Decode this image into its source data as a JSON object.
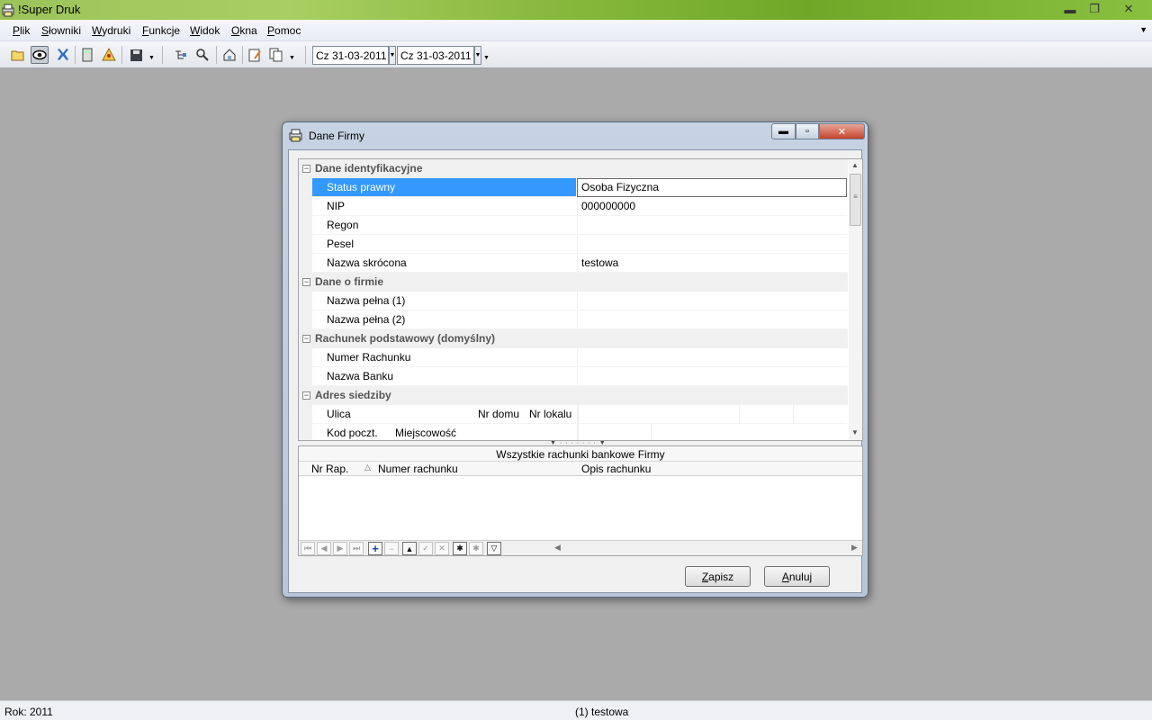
{
  "app": {
    "title": "!Super Druk",
    "caption_minimize": "▬",
    "caption_restore": "❐",
    "caption_close": "✕"
  },
  "menu": {
    "items": [
      {
        "accel": "P",
        "rest": "lik"
      },
      {
        "accel": "S",
        "rest": "łowniki"
      },
      {
        "accel": "W",
        "rest": "ydruki"
      },
      {
        "accel": "F",
        "rest": "unkcje"
      },
      {
        "accel": "W",
        "rest": "idok"
      },
      {
        "accel": "O",
        "rest": "kna"
      },
      {
        "accel": "P",
        "rest": "omoc"
      }
    ],
    "overflow": "▼"
  },
  "toolbar": {
    "date_from": "Cz 31-03-2011",
    "date_to": "Cz 31-03-2011",
    "caret": "▼"
  },
  "status": {
    "year": "Rok: 2011",
    "company": "(1) testowa"
  },
  "dialog": {
    "title": "Dane Firmy",
    "caption_min": "▬",
    "caption_max": "▫",
    "caption_close": "✕",
    "toggle": "−",
    "categories": {
      "identification": "Dane identyfikacyjne",
      "about": "Dane o firmie",
      "account": "Rachunek podstawowy (domyślny)",
      "address": "Adres siedziby"
    },
    "fields": {
      "status_label": "Status prawny",
      "status_value": "Osoba Fizyczna",
      "nip_label": "NIP",
      "nip_value": "000000000",
      "regon_label": "Regon",
      "pesel_label": "Pesel",
      "short_name_label": "Nazwa skrócona",
      "short_name_value": "testowa",
      "full_name1_label": "Nazwa pełna (1)",
      "full_name2_label": "Nazwa pełna (2)",
      "account_number_label": "Numer Rachunku",
      "bank_name_label": "Nazwa Banku",
      "street_label": "Ulica",
      "house_no_label": "Nr domu",
      "flat_no_label": "Nr lokalu",
      "postal_code_label": "Kod poczt.",
      "city_label": "Miejscowość"
    },
    "grid": {
      "caption": "Wszystkie rachunki bankowe Firmy",
      "columns": [
        "Nr Rap.",
        "Numer rachunku",
        "Opis rachunku"
      ],
      "sort_icon": "△",
      "nav": [
        "⏮",
        "◀",
        "▶",
        "⏭",
        "+",
        "−",
        "▲",
        "✓",
        "✕",
        "✱",
        "✱",
        "▽"
      ]
    },
    "buttons": {
      "save_accel": "Z",
      "save_rest": "apisz",
      "cancel_accel": "A",
      "cancel_rest": "nuluj"
    }
  }
}
